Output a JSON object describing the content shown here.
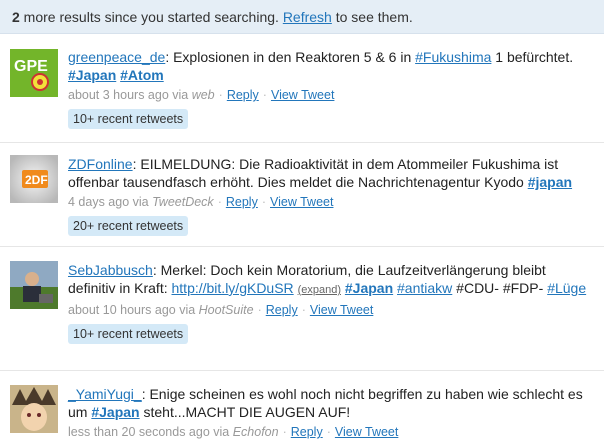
{
  "banner": {
    "count": "2",
    "text": " more results since you started searching. ",
    "refresh": "Refresh",
    "tail": " to see them."
  },
  "tweets": [
    {
      "user": "greenpeace_de",
      "text1": ": Explosionen in den Reaktoren 5 & 6 in ",
      "tag1": "#Fukushima",
      "text2": " 1 befürchtet. ",
      "tag2": "#Japan",
      "tag3": "#Atom",
      "time": "about 3 hours ago via ",
      "source": "web",
      "reply": "Reply",
      "view": "View Tweet",
      "retweets": "10+ recent retweets",
      "avatar_text": "GPE",
      "avatar_color": "#73b52a"
    },
    {
      "user": "ZDFonline",
      "text1": ": EILMELDUNG: Die Radioaktivität in dem Atommeiler Fukushima ist offenbar tausendfasch erhöht. Dies meldet die Nachrichtenagentur Kyodo ",
      "tag1": "#japan",
      "time": "4 days ago via ",
      "source": "TweetDeck",
      "reply": "Reply",
      "view": "View Tweet",
      "retweets": "20+ recent retweets",
      "avatar_text": "2DF",
      "avatar_color": "#f08a1c"
    },
    {
      "user": "SebJabbusch",
      "text1": ": Merkel: Doch kein Moratorium, die Laufzeitverlängerung bleibt definitiv in Kraft: ",
      "link": "http://bit.ly/gKDuSR",
      "expand": "(expand)",
      "tag1": "#Japan",
      "tag2": "#antiakw",
      "text2": " #CDU- #FDP- ",
      "tag3": "#Lüge",
      "time": "about 10 hours ago via ",
      "source": "HootSuite",
      "reply": "Reply",
      "view": "View Tweet",
      "retweets": "10+ recent retweets"
    },
    {
      "user": "_YamiYugi_",
      "text1": ": Enige scheinen es wohl noch nicht begriffen zu haben wie schlecht es um ",
      "tag1": "#Japan",
      "text2": " steht...MACHT DIE AUGEN AUF!",
      "time": "less than 20 seconds ago via ",
      "source": "Echofon",
      "reply": "Reply",
      "view": "View Tweet"
    }
  ],
  "colors": {
    "link": "#2276bb",
    "banner_bg": "#e5eef6",
    "retweet_bg": "#d4e9f7"
  }
}
